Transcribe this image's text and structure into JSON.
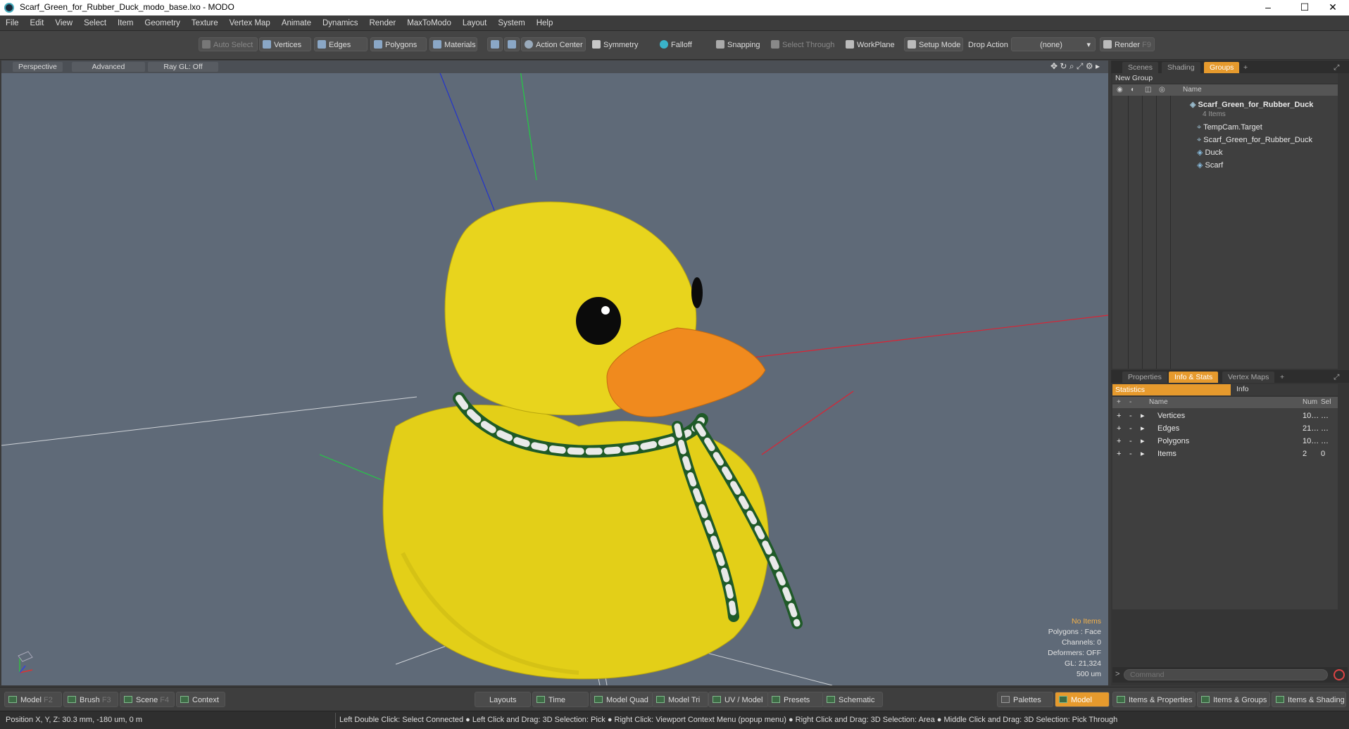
{
  "window": {
    "title": "Scarf_Green_for_Rubber_Duck_modo_base.lxo - MODO",
    "minimize": "–",
    "maximize": "☐",
    "close": "✕"
  },
  "menu": [
    "File",
    "Edit",
    "View",
    "Select",
    "Item",
    "Geometry",
    "Texture",
    "Vertex Map",
    "Animate",
    "Dynamics",
    "Render",
    "MaxToModo",
    "Layout",
    "System",
    "Help"
  ],
  "toolbar": {
    "auto_select": "Auto Select",
    "vertices": "Vertices",
    "edges": "Edges",
    "polygons": "Polygons",
    "materials": "Materials",
    "action_center": "Action Center",
    "symmetry": "Symmetry",
    "falloff": "Falloff",
    "snapping": "Snapping",
    "select_through": "Select Through",
    "workplane": "WorkPlane",
    "setup_mode": "Setup Mode",
    "drop_action": "Drop Action",
    "drop_value": "(none)",
    "render": "Render",
    "render_key": "F9"
  },
  "viewport": {
    "tabs": [
      "Perspective",
      "Advanced",
      "Ray GL: Off"
    ],
    "info": {
      "no_items": "No Items",
      "polygons": "Polygons : Face",
      "channels": "Channels: 0",
      "deformers": "Deformers: OFF",
      "gl": "GL: 21,324",
      "scale": "500 um"
    }
  },
  "scene_panel": {
    "tabs": [
      "Scenes",
      "Shading",
      "Groups"
    ],
    "active_tab": "Groups",
    "new_group": "New Group",
    "name_col": "Name",
    "root": {
      "name": "Scarf_Green_for_Rubber_Duck",
      "count": "4 Items"
    },
    "items": [
      "TempCam.Target",
      "Scarf_Green_for_Rubber_Duck",
      "Duck",
      "Scarf"
    ]
  },
  "props_panel": {
    "tabs": [
      "Properties",
      "Info & Stats",
      "Vertex Maps"
    ],
    "active_tab": "Info & Stats",
    "subtabs": [
      "Statistics",
      "Info"
    ],
    "cols": {
      "name": "Name",
      "num": "Num",
      "sel": "Sel"
    },
    "rows": [
      {
        "name": "Vertices",
        "num": "10…",
        "sel": "…"
      },
      {
        "name": "Edges",
        "num": "21…",
        "sel": "…"
      },
      {
        "name": "Polygons",
        "num": "10…",
        "sel": "…"
      },
      {
        "name": "Items",
        "num": "2",
        "sel": "0"
      }
    ],
    "command_placeholder": "Command"
  },
  "bottom": {
    "model": "Model",
    "model_key": "F2",
    "brush": "Brush",
    "brush_key": "F3",
    "scene": "Scene",
    "scene_key": "F4",
    "context": "Context",
    "layouts": "Layouts",
    "time": "Time",
    "model_quad": "Model Quad",
    "model_tri": "Model Tri",
    "uv_model": "UV / Model",
    "presets": "Presets",
    "schematic": "Schematic",
    "palettes": "Palettes",
    "model_active": "Model",
    "items_props": "Items & Properties",
    "items_groups": "Items & Groups",
    "items_shading": "Items & Shading"
  },
  "status": {
    "position": "Position X, Y, Z:   30.3 mm, -180 um, 0 m",
    "hints": "Left Double Click: Select Connected ● Left Click and Drag: 3D Selection: Pick ● Right Click: Viewport Context Menu (popup menu) ● Right Click and Drag: 3D Selection: Area ● Middle Click and Drag: 3D Selection: Pick Through"
  },
  "colors": {
    "accent": "#e69a2d",
    "duck": "#e6d21e",
    "beak": "#f08a1e",
    "viewport_bg": "#5f6a78"
  }
}
